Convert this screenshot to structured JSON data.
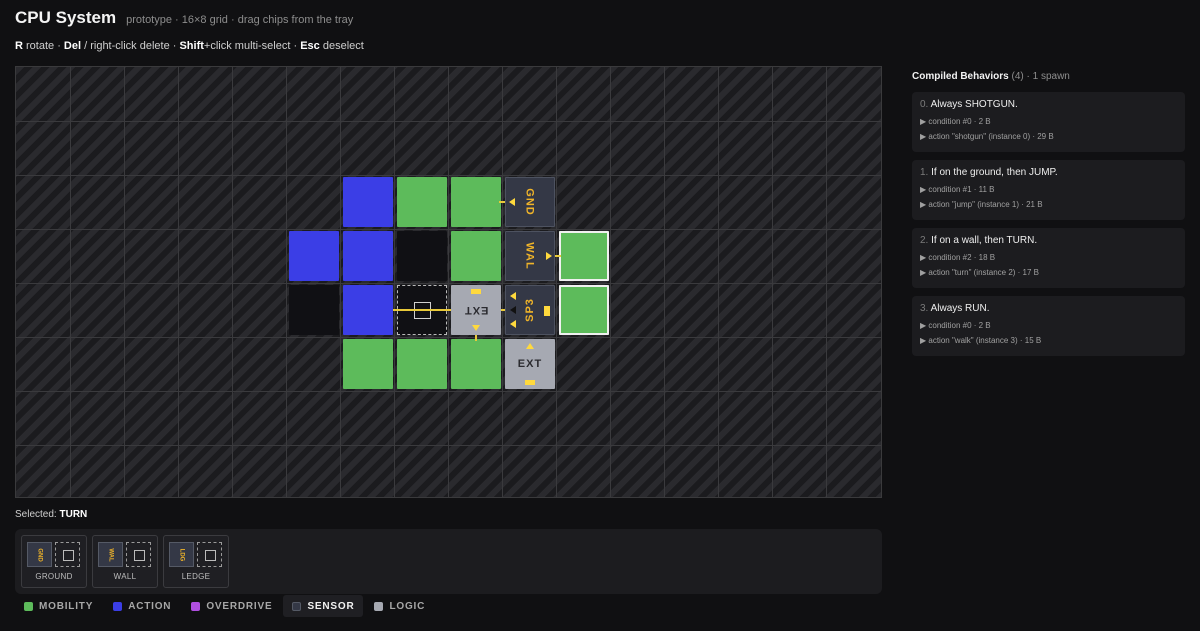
{
  "header": {
    "title": "CPU System",
    "subtitle": "prototype · 16×8 grid · drag chips from the tray"
  },
  "help": {
    "k1": "R",
    "t1": " rotate · ",
    "k2": "Del",
    "t2": " / right-click delete · ",
    "k3": "Shift",
    "t3": "+click multi-select · ",
    "k4": "Esc",
    "t4": " deselect"
  },
  "board": {
    "chips": [
      {
        "name": "GND",
        "type": "sensor"
      },
      {
        "name": "WAL",
        "type": "sensor"
      },
      {
        "name": "SP3",
        "type": "sensor"
      },
      {
        "name": "EXT",
        "type": "logic"
      },
      {
        "name": "EXT",
        "type": "logic"
      }
    ]
  },
  "selected": {
    "label": "Selected: ",
    "value": "TURN"
  },
  "tray": {
    "items": [
      {
        "short": "GND",
        "label": "GROUND"
      },
      {
        "short": "WAL",
        "label": "WALL"
      },
      {
        "short": "LDG",
        "label": "LEDGE"
      }
    ]
  },
  "tabs": [
    {
      "label": "MOBILITY",
      "color": "#5dbb5b"
    },
    {
      "label": "ACTION",
      "color": "#3b3ee6"
    },
    {
      "label": "OVERDRIVE",
      "color": "#b04fe0"
    },
    {
      "label": "SENSOR",
      "color": "#343846"
    },
    {
      "label": "LOGIC",
      "color": "#a6a9b2"
    }
  ],
  "sidebar": {
    "title": "Compiled Behaviors",
    "count": "(4)",
    "spawn": " · 1 spawn",
    "behaviors": [
      {
        "idx": "0.",
        "title": "Always SHOTGUN.",
        "cond": "▶ condition #0 · 2 B",
        "action": "▶ action \"shotgun\" (instance 0) · 29 B"
      },
      {
        "idx": "1.",
        "title": "If on the ground, then JUMP.",
        "cond": "▶ condition #1 · 11 B",
        "action": "▶ action \"jump\" (instance 1) · 21 B"
      },
      {
        "idx": "2.",
        "title": "If on a wall, then TURN.",
        "cond": "▶ condition #2 · 18 B",
        "action": "▶ action \"turn\" (instance 2) · 17 B"
      },
      {
        "idx": "3.",
        "title": "Always RUN.",
        "cond": "▶ condition #0 · 2 B",
        "action": "▶ action \"walk\" (instance 3) · 15 B"
      }
    ]
  }
}
